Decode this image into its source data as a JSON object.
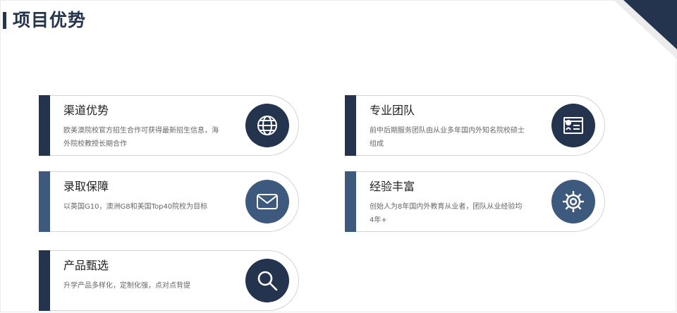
{
  "page": {
    "title": "项目优势"
  },
  "colors": {
    "dark": "#24344e",
    "mid": "#3d5a7e",
    "corner_light": "#ececec"
  },
  "cards": [
    {
      "title": "渠道优势",
      "desc": "欧美澳院校官方招生合作可获得最新招生信息，海外院校教授长期合作",
      "icon": "globe-icon"
    },
    {
      "title": "专业团队",
      "desc": "前中后期服务团队由从业多年国内外知名院校硕士组成",
      "icon": "id-card-icon"
    },
    {
      "title": "录取保障",
      "desc": "以英国G10，澳洲G8和美国Top40院校为目标",
      "icon": "envelope-icon"
    },
    {
      "title": "经验丰富",
      "desc": "创始人为8年国内外教育从业者，团队从业经验均4年+",
      "icon": "gear-icon"
    },
    {
      "title": "产品甄选",
      "desc": "升学产品多样化，定制化强，点对点背提",
      "icon": "search-icon"
    }
  ]
}
